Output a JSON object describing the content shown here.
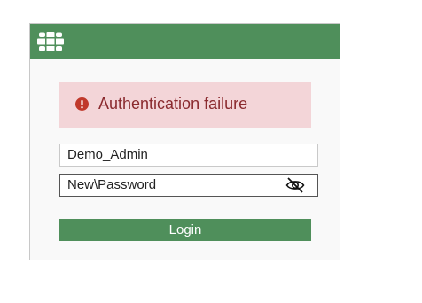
{
  "login_form": {
    "error_message": "Authentication failure",
    "username_value": "Demo_Admin",
    "password_value": "New\\Password",
    "login_label": "Login",
    "password_toggle_icon": "eye-slash-icon",
    "header_logo_icon": "fortinet-logo-icon",
    "error_icon": "exclamation-circle-icon"
  },
  "colors": {
    "header_green": "#4f8f5b",
    "button_green": "#4f8f5b",
    "error_background": "#f3d5d8",
    "error_text": "#8a2a2e",
    "error_icon": "#c0392b",
    "card_background": "#f9f9f9"
  }
}
